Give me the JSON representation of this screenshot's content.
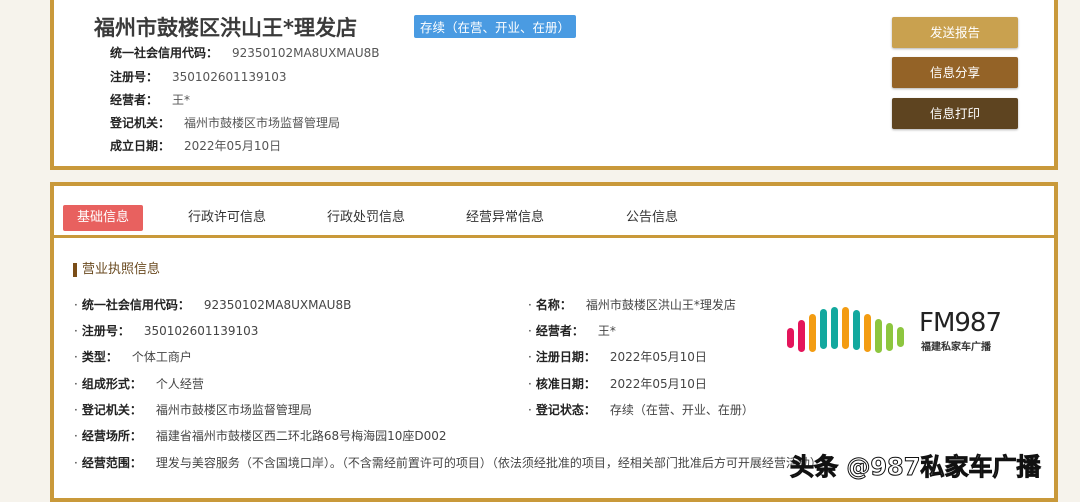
{
  "header": {
    "title": "福州市鼓楼区洪山王*理发店",
    "status_badge": "存续（在营、开业、在册）",
    "fields": [
      {
        "label": "统一社会信用代码：",
        "value": "92350102MA8UXMAU8B"
      },
      {
        "label": "注册号：",
        "value": "350102601139103"
      },
      {
        "label": "经营者：",
        "value": "王*"
      },
      {
        "label": "登记机关：",
        "value": "福州市鼓楼区市场监督管理局"
      },
      {
        "label": "成立日期：",
        "value": "2022年05月10日"
      }
    ],
    "buttons": {
      "send_report": "发送报告",
      "share": "信息分享",
      "print": "信息打印"
    },
    "button_colors": [
      "#c9a14f",
      "#946327",
      "#5e4420"
    ]
  },
  "tabs": [
    "基础信息",
    "行政许可信息",
    "行政处罚信息",
    "经营异常信息",
    "公告信息"
  ],
  "section": {
    "title": "营业执照信息",
    "left": [
      {
        "label": "统一社会信用代码：",
        "value": "92350102MA8UXMAU8B"
      },
      {
        "label": "注册号：",
        "value": "350102601139103"
      },
      {
        "label": "类型：",
        "value": "个体工商户"
      },
      {
        "label": "组成形式：",
        "value": "个人经营"
      },
      {
        "label": "登记机关：",
        "value": "福州市鼓楼区市场监督管理局"
      },
      {
        "label": "经营场所：",
        "value": "福建省福州市鼓楼区西二环北路68号梅海园10座D002"
      },
      {
        "label": "经营范围：",
        "value": "理发与美容服务（不含国境口岸）。（不含需经前置许可的项目）（依法须经批准的项目，经相关部门批准后方可开展经营活动）"
      }
    ],
    "right": [
      {
        "label": "名称：",
        "value": "福州市鼓楼区洪山王*理发店"
      },
      {
        "label": "经营者：",
        "value": "王*"
      },
      {
        "label": "注册日期：",
        "value": "2022年05月10日"
      },
      {
        "label": "核准日期：",
        "value": "2022年05月10日"
      },
      {
        "label": "登记状态：",
        "value": "存续（在营、开业、在册）"
      }
    ]
  },
  "logo": {
    "name": "FM987",
    "subtitle": "福建私家车广播"
  },
  "watermark": "头条 @987私家车广播"
}
